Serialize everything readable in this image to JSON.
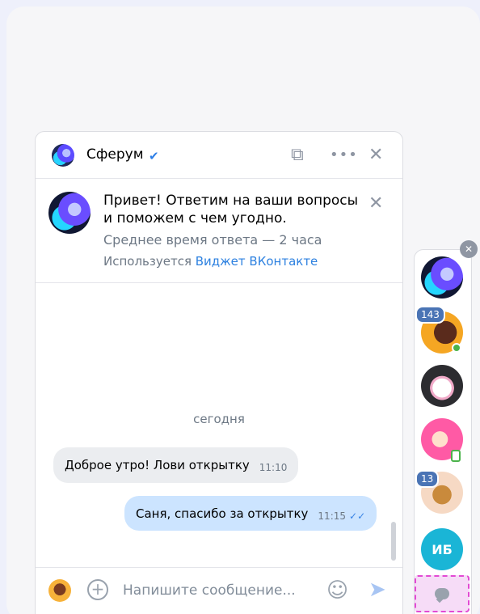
{
  "header": {
    "title": "Сферум",
    "verified_icon": "✔",
    "open_external_icon": "⧉",
    "more_icon": "•••",
    "close_icon": "✕"
  },
  "greeting": {
    "text": "Привет! Ответим на ваши вопросы и поможем с чем угодно.",
    "response_time": "Среднее время ответа — 2 часа",
    "used_prefix": "Используется ",
    "used_link": "Виджет ВКонтакте",
    "close_icon": "✕"
  },
  "messages": {
    "day_label": "сегодня",
    "items": [
      {
        "direction": "in",
        "text": "Доброе утро! Лови открытку",
        "time": "11:10"
      },
      {
        "direction": "out",
        "text": "Саня, спасибо за открытку",
        "time": "11:15",
        "status_icon": "✓✓"
      }
    ]
  },
  "composer": {
    "placeholder": "Напишите сообщение...",
    "plus_icon": "+",
    "emoji_icon": "☺",
    "send_icon": "➤"
  },
  "rail": {
    "close_icon": "✕",
    "badges": [
      "143",
      "13"
    ],
    "initials": "ИБ"
  }
}
